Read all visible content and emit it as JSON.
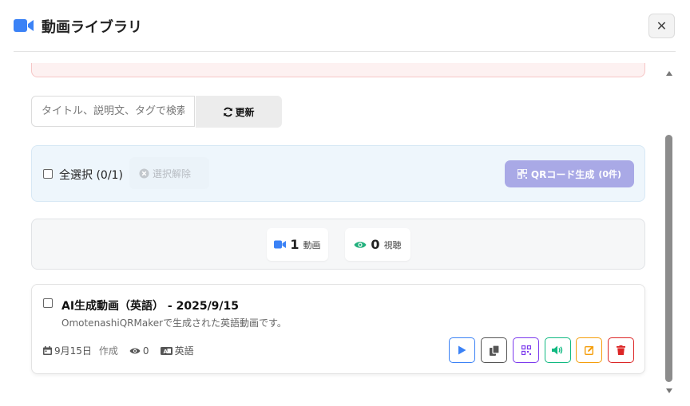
{
  "header": {
    "title": "動画ライブラリ",
    "title_icon": "video-camera-icon",
    "close_label": "✕"
  },
  "toolbar": {
    "search_placeholder": "タイトル、説明文、タグで検索",
    "refresh_label": "更新"
  },
  "selection": {
    "select_all_label": "全選択 (0/1)",
    "deselect_label": "選択解除",
    "qr_label": "QRコード生成",
    "qr_count": "(0件)"
  },
  "stats": {
    "videos_count": "1",
    "videos_label": "動画",
    "views_count": "0",
    "views_label": "視聴"
  },
  "videos": [
    {
      "title": "AI生成動画（英語） - 2025/9/15",
      "description": "OmotenashiQRMakerで生成された英語動画です。",
      "date": "9月15日",
      "created_label": "作成",
      "views": "0",
      "language": "英語",
      "actions": [
        "play-icon",
        "copy-icon",
        "qr-code-icon",
        "volume-icon",
        "edit-icon",
        "trash-icon"
      ]
    }
  ],
  "colors": {
    "accent_blue": "#3b82f6",
    "accent_green": "#22b07d",
    "qr_button": "#a9a9e6",
    "play": "#3b82f6",
    "copy": "#555555",
    "qr": "#7c3aed",
    "audio": "#10b981",
    "edit": "#f59e0b",
    "delete": "#dc2626"
  }
}
